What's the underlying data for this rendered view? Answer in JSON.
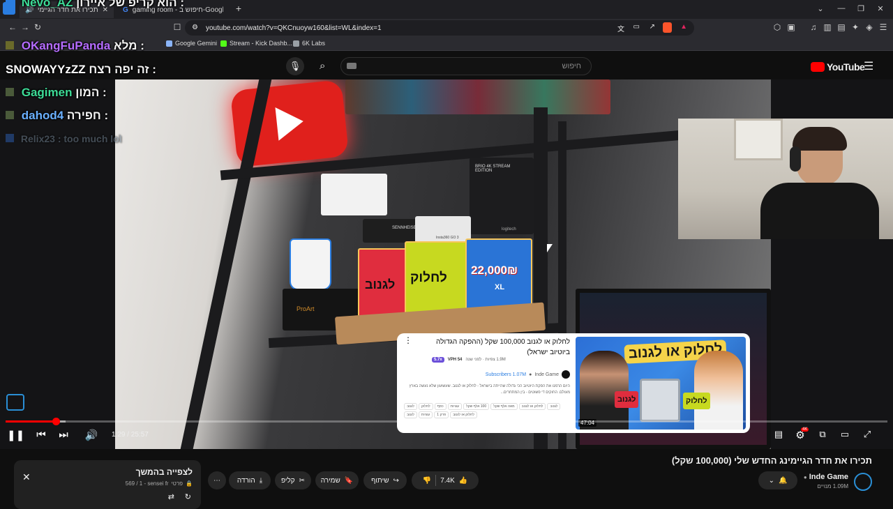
{
  "browser": {
    "tabs": [
      {
        "label": "תכירו את חדר הגיימינג הח (3)"
      },
      {
        "label": "gaming room - חיפוש ב-Google"
      }
    ],
    "url": "youtube.com/watch?v=QKCnuoyw160&list=WL&index=1",
    "bookmarks": [
      {
        "label": "Google Gemini",
        "color": "#8ab4f8"
      },
      {
        "label": "Stream - Kick Dashb...",
        "color": "#53fc18"
      },
      {
        "label": "6K Labs",
        "color": "#9aa0a6"
      }
    ]
  },
  "youtube": {
    "logo_text": "YouTube",
    "search_placeholder": "חיפוש"
  },
  "chat": [
    {
      "user": "Nevo_AZ",
      "message": "הוא קריפ של איירון :",
      "color": "#3ddc97"
    },
    {
      "user": "OKangFuPanda",
      "message": "מלא :",
      "color": "#b56cff"
    },
    {
      "user": "SNOWAYYzZZ",
      "message": "זה יפה רצח :",
      "color": "#ffffff"
    },
    {
      "user": "Gagimen",
      "message": "המון :",
      "color": "#3ddc97"
    },
    {
      "user": "dahod4",
      "message": "חפירה :",
      "color": "#6ab0ff"
    },
    {
      "user": "Relix23",
      "message": ": too much lol",
      "color": "#6a7a8a"
    }
  ],
  "scene": {
    "box_red": "לגנוב",
    "box_green": "לחלוק",
    "box_blue": "22,000₪",
    "box_blue_sub": "XL",
    "camera_brand": "SENNHEISER",
    "cam_label": "BRIO 4K STREAM EDITION",
    "logitech": "logitech",
    "insta": "Insta360 GO 3",
    "asus": "ProArt"
  },
  "card": {
    "title": "לחלוק או לגנוב 100,000 שקל (ההפקה הגדולה ביוטיוב ישראל)",
    "views_meta": "1.9M צפיות · לפני שנה",
    "vph": "VPH 54",
    "badge": "5.7x",
    "subscribers": "Subscribers 1.07M",
    "channel": "Inde Game",
    "description": "היום הרמנו את הפקת היוטיוב הכי גדולה שהייתה בישראל - לחלוק או לגנוב. שעשועון שלא נעשה בארץ מעולם. החוקים די פשוטים - בין המתחרים...",
    "tags": [
      "לגנוב",
      "לחלוק או לגנוב",
      "מאה אלף שקל",
      "100 אלף שקל",
      "עוגיות",
      "כסף",
      "לחלוק",
      "לגנוב",
      "לחלוק או לגנוב",
      "פרק 1",
      "עוגיות",
      "לגנוב"
    ],
    "thumb_title": "לחלוק או לגנוב",
    "thumb_red": "לגנוב",
    "thumb_green": "לחלוק",
    "duration": "47:04"
  },
  "player": {
    "time": "1:29 / 25:57",
    "played_fraction": 0.057,
    "loaded_fraction": 0.068,
    "settings_badge": "4K"
  },
  "video_info": {
    "title": "תכירו את חדר הגיימינג החדש שלי (100,000 שקל)",
    "channel": "Inde Game",
    "subscribers": "1.09M מנויים",
    "likes": "7.4K",
    "share": "שיתוף",
    "save": "שמירה",
    "clip": "קליפ",
    "download": "הורדה"
  },
  "playlist": {
    "title": "לצפייה בהמשך",
    "meta": "569 / 1 - sensei fr",
    "privacy": "פרטי"
  }
}
